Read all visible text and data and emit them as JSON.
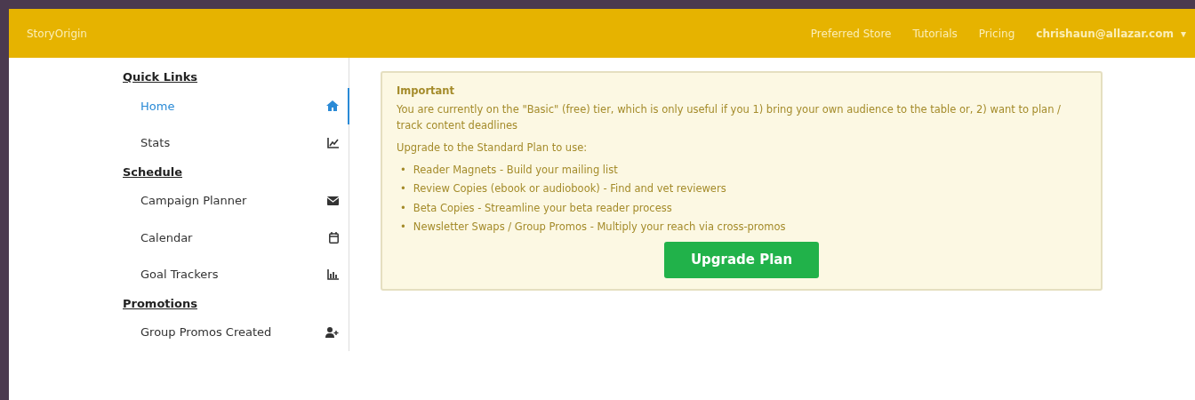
{
  "navbar": {
    "brand": "StoryOrigin",
    "links": [
      "Preferred Store",
      "Tutorials",
      "Pricing"
    ],
    "user": "chrishaun@allazar.com",
    "caret": "▾"
  },
  "sidebar": {
    "sections": [
      {
        "title": "Quick Links",
        "items": [
          {
            "label": "Home",
            "selected": true
          },
          {
            "label": "Stats",
            "selected": false
          }
        ]
      },
      {
        "title": "Schedule",
        "items": [
          {
            "label": "Campaign Planner",
            "selected": false
          },
          {
            "label": "Calendar",
            "selected": false
          },
          {
            "label": "Goal Trackers",
            "selected": false
          }
        ]
      },
      {
        "title": "Promotions",
        "items": [
          {
            "label": "Group Promos Created",
            "selected": false
          }
        ]
      }
    ]
  },
  "notice": {
    "heading": "Important",
    "message": "You are currently on the \"Basic\" (free) tier, which is only useful if you 1) bring your own audience to the table or, 2) want to plan / track content deadlines",
    "intro": "Upgrade to the Standard Plan to use:",
    "bullet": "•",
    "features": [
      "Reader Magnets - Build your mailing list",
      "Review Copies (ebook or audiobook) - Find and vet reviewers",
      "Beta Copies - Streamline your beta reader process",
      "Newsletter Swaps / Group Promos - Multiply your reach via cross-promos"
    ],
    "button": "Upgrade Plan"
  }
}
